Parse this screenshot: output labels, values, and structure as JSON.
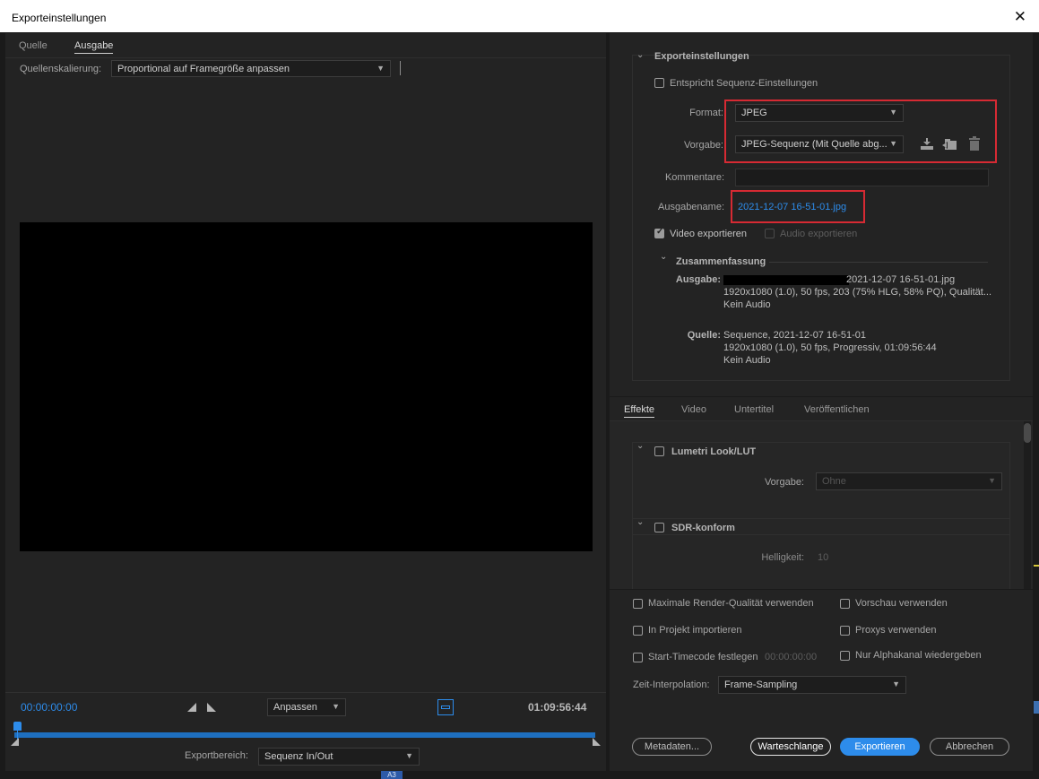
{
  "window": {
    "title": "Exporteinstellungen",
    "close_glyph": "✕"
  },
  "left": {
    "tabs": [
      {
        "label": "Quelle"
      },
      {
        "label": "Ausgabe"
      }
    ],
    "scaling_label": "Quellenskalierung:",
    "scaling_value": "Proportional auf Framegröße anpassen",
    "timecode_start": "00:00:00:00",
    "timecode_end": "01:09:56:44",
    "fit_value": "Anpassen",
    "range_label": "Exportbereich:",
    "range_value": "Sequenz In/Out"
  },
  "export": {
    "header": "Exporteinstellungen",
    "match_sequence_label": "Entspricht Sequenz-Einstellungen",
    "format_label": "Format:",
    "format_value": "JPEG",
    "preset_label": "Vorgabe:",
    "preset_value": "JPEG-Sequenz (Mit Quelle abg...",
    "comment_label": "Kommentare:",
    "comment_value": "",
    "outname_label": "Ausgabename:",
    "outname_value": "2021-12-07 16-51-01.jpg",
    "video_export_label": "Video exportieren",
    "audio_export_label": "Audio exportieren",
    "video_export_checked": true,
    "audio_export_checked": false
  },
  "summary": {
    "header": "Zusammenfassung",
    "output_label": "Ausgabe:",
    "output_lines": [
      "2021-12-07 16-51-01.jpg",
      "1920x1080 (1.0), 50 fps, 203 (75% HLG, 58% PQ), Qualität...",
      "Kein Audio"
    ],
    "source_label": "Quelle:",
    "source_lines": [
      "Sequence, 2021-12-07 16-51-01",
      "1920x1080 (1.0), 50 fps, Progressiv, 01:09:56:44",
      "Kein Audio"
    ]
  },
  "lower_tabs": [
    {
      "label": "Effekte"
    },
    {
      "label": "Video"
    },
    {
      "label": "Untertitel"
    },
    {
      "label": "Veröffentlichen"
    }
  ],
  "effects": {
    "lumetri_label": "Lumetri Look/LUT",
    "lumetri_preset_label": "Vorgabe:",
    "lumetri_preset_value": "Ohne",
    "sdr_label": "SDR-konform",
    "brightness_label": "Helligkeit:",
    "brightness_value": "10"
  },
  "options": {
    "max_render": "Maximale Render-Qualität verwenden",
    "preview": "Vorschau verwenden",
    "import_project": "In Projekt importieren",
    "proxies": "Proxys verwenden",
    "start_timecode": "Start-Timecode festlegen",
    "start_timecode_value": "00:00:00:00",
    "alpha_only": "Nur Alphakanal wiedergeben",
    "interp_label": "Zeit-Interpolation:",
    "interp_value": "Frame-Sampling"
  },
  "buttons": {
    "metadata": "Metadaten...",
    "queue": "Warteschlange",
    "export": "Exportieren",
    "cancel": "Abbrechen"
  },
  "bottom_strip": {
    "track_label": "A3"
  },
  "colors": {
    "accent": "#2d8ceb",
    "highlight": "#d62a33",
    "panel": "#232323"
  }
}
